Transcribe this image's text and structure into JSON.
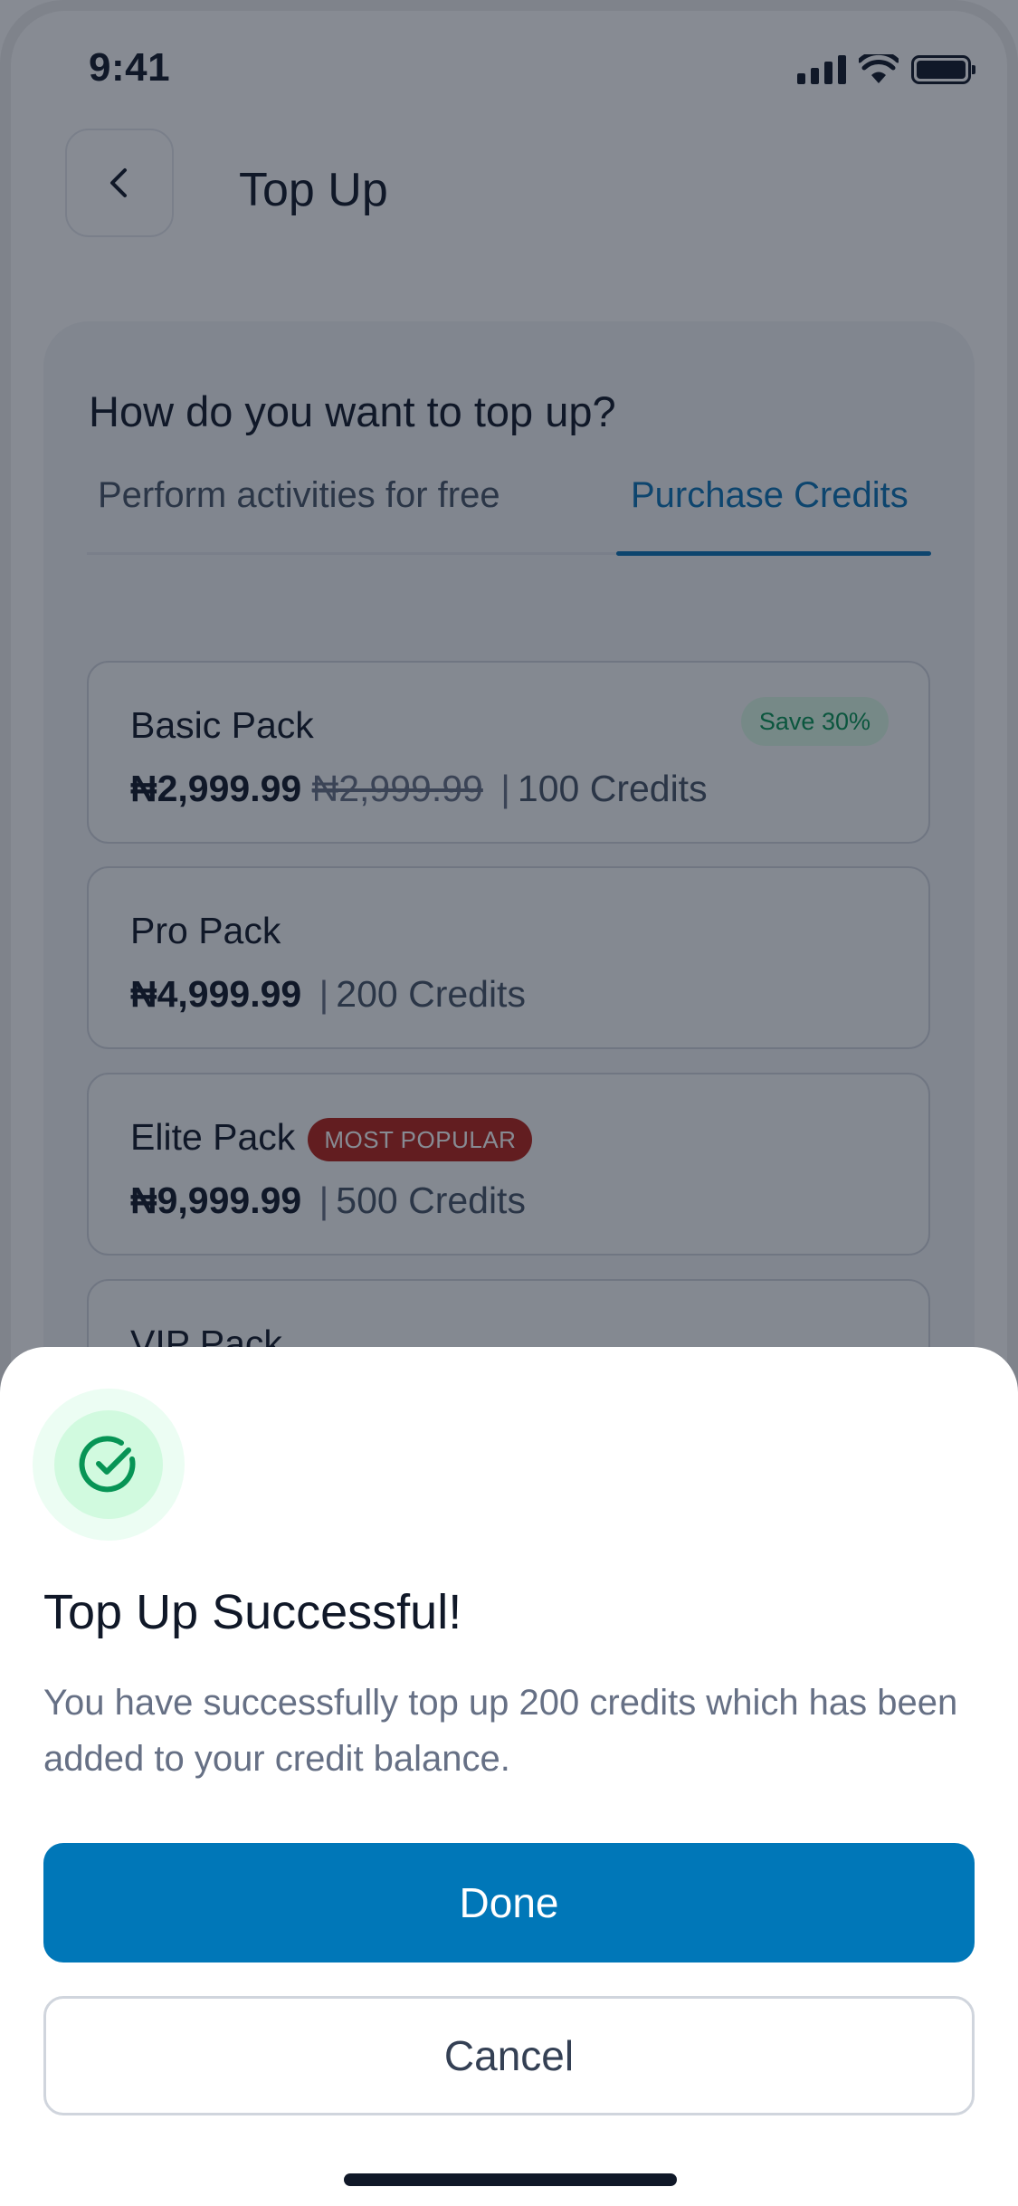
{
  "status_bar": {
    "time": "9:41"
  },
  "header": {
    "title": "Top Up"
  },
  "card": {
    "question": "How do you want to top up?",
    "tabs": [
      {
        "label": "Perform activities for free",
        "active": false
      },
      {
        "label": "Purchase Credits",
        "active": true
      }
    ]
  },
  "packs": [
    {
      "name": "Basic Pack",
      "price": "₦2,999.99",
      "old_price": "₦2,999.99",
      "separator": "|",
      "credits": "100 Credits",
      "badge": "Save 30%"
    },
    {
      "name": "Pro Pack",
      "price": "₦4,999.99",
      "separator": "|",
      "credits": "200 Credits"
    },
    {
      "name": "Elite Pack",
      "price": "₦9,999.99",
      "separator": "|",
      "credits": "500 Credits",
      "badge": "MOST POPULAR"
    },
    {
      "name": "VIP Pack"
    }
  ],
  "sheet": {
    "icon": "check-circle-icon",
    "title": "Top Up Successful!",
    "description": "You have successfully top up 200 credits which has been added to your credit balance.",
    "done_label": "Done",
    "cancel_label": "Cancel"
  },
  "colors": {
    "primary": "#0077b8",
    "tab_active": "#0b72b5",
    "success": "#079455",
    "popular_badge": "#b42318"
  }
}
